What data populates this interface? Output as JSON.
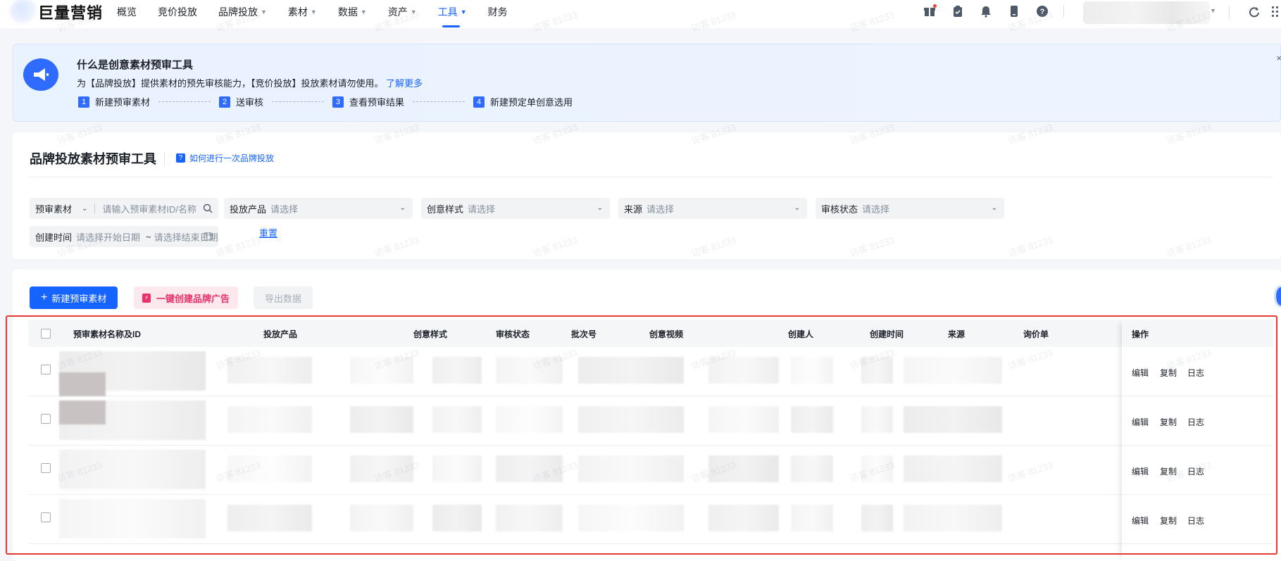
{
  "nav": {
    "brand": "巨量营销",
    "items": [
      {
        "label": "概览",
        "caret": false,
        "active": false
      },
      {
        "label": "竞价投放",
        "caret": false,
        "active": false
      },
      {
        "label": "品牌投放",
        "caret": true,
        "active": false
      },
      {
        "label": "素材",
        "caret": true,
        "active": false
      },
      {
        "label": "数据",
        "caret": true,
        "active": false
      },
      {
        "label": "资产",
        "caret": true,
        "active": false
      },
      {
        "label": "工具",
        "caret": true,
        "active": true
      },
      {
        "label": "财务",
        "caret": false,
        "active": false
      }
    ],
    "icons": [
      "gift-icon",
      "clipboard-icon",
      "bell-icon",
      "tablet-icon",
      "help-icon"
    ]
  },
  "banner": {
    "title": "什么是创意素材预审工具",
    "desc_prefix": "为【品牌投放】提供素材的预先审核能力，【竞价投放】投放素材请勿使用。",
    "desc_link": "了解更多",
    "steps": [
      {
        "num": "1",
        "label": "新建预审素材"
      },
      {
        "num": "2",
        "label": "送审核"
      },
      {
        "num": "3",
        "label": "查看预审结果"
      },
      {
        "num": "4",
        "label": "新建预定单创意选用"
      }
    ],
    "close": "×"
  },
  "filters": {
    "title": "品牌投放素材预审工具",
    "help_link": "如何进行一次品牌投放",
    "material_select": "预审素材",
    "material_placeholder": "请输入预审素材ID/名称",
    "product_label": "投放产品",
    "creative_label": "创意样式",
    "source_label": "来源",
    "review_label": "审核状态",
    "select_placeholder": "请选择",
    "time_label": "创建时间",
    "start_placeholder": "请选择开始日期",
    "tilde": "~",
    "end_placeholder": "请选择结束日期",
    "reset": "重置"
  },
  "toolbar": {
    "new_material": "新建预审素材",
    "one_click": "一键创建品牌广告",
    "export": "导出数据"
  },
  "table": {
    "columns": [
      "预审素材名称及ID",
      "投放产品",
      "创意样式",
      "审核状态",
      "批次号",
      "创意视频",
      "创建人",
      "创建时间",
      "来源",
      "询价单",
      "操作"
    ],
    "row_actions": [
      "编辑",
      "复制",
      "日志"
    ],
    "row_count": 4
  },
  "watermark": "访客 81233",
  "colors": {
    "accent": "#1664ff",
    "pink": "#e8306a",
    "highlight": "#e53935"
  }
}
